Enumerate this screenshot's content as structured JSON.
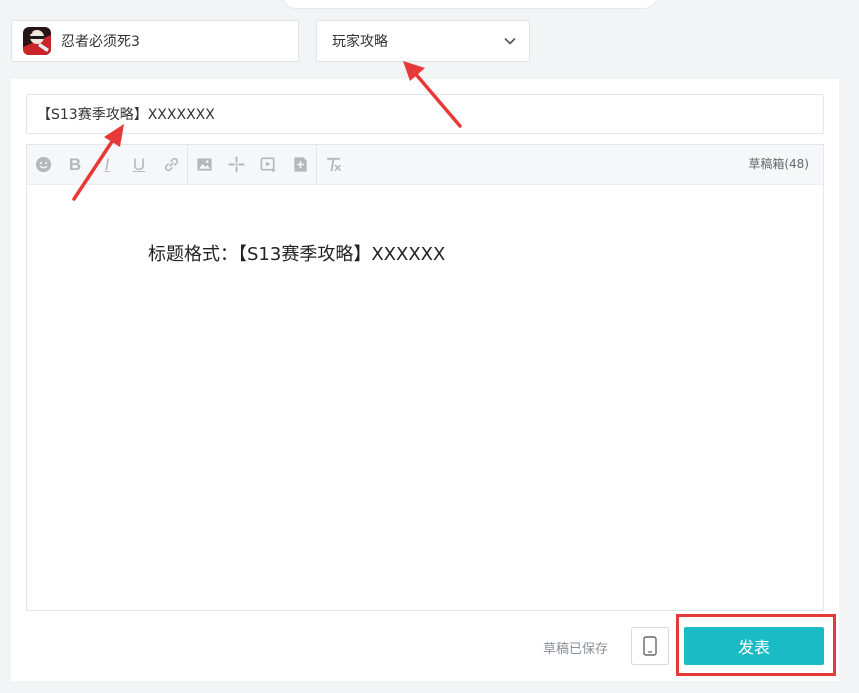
{
  "game_select": {
    "icon": "game-avatar-icon",
    "name": "忍者必须死3"
  },
  "category_select": {
    "value": "玩家攻略",
    "icon": "chevron-down-icon"
  },
  "title_field": {
    "value": "【S13赛季攻略】XXXXXXX"
  },
  "toolbar": {
    "groups": [
      [
        "emoji-icon",
        "bold-icon",
        "italic-icon",
        "underline-icon",
        "link-icon"
      ],
      [
        "image-icon",
        "game-element-icon",
        "video-icon",
        "add-block-icon"
      ],
      [
        "clear-format-icon"
      ]
    ],
    "bold_label": "B",
    "italic_label": "I",
    "underline_label": "U",
    "drafts_label": "草稿箱(48)"
  },
  "editor": {
    "body_text": "标题格式：【S13赛季攻略】XXXXXX"
  },
  "footer": {
    "status_text": "草稿已保存",
    "preview_icon": "mobile-phone-icon",
    "publish_label": "发表"
  },
  "annotations": {
    "arrow_color": "#e8393a",
    "highlight_color": "#e8393a"
  },
  "colors": {
    "accent": "#1bbbc5",
    "background": "#f3f4f6"
  }
}
